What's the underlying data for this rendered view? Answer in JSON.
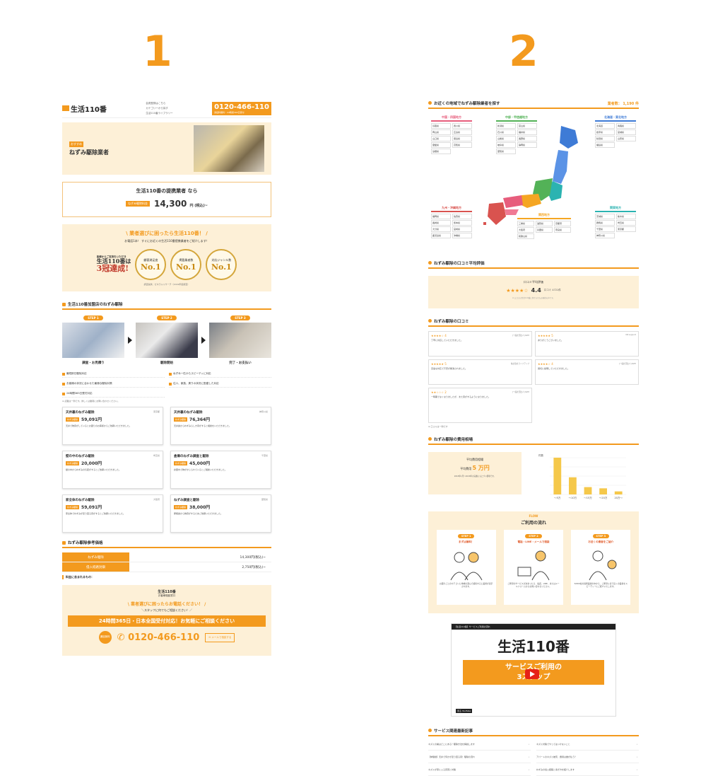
{
  "labels": {
    "one": "1",
    "two": "2"
  },
  "colors": {
    "accent": "#f39a1e",
    "bg_cream": "#fdf0d7"
  },
  "left": {
    "header": {
      "logo": "生活110番",
      "links": [
        "会員登録はこちら",
        "カテゴリーから探す",
        "生活110番ライブラリー"
      ],
      "phone": "0120-466-110",
      "phone_note": "通話料無料・24時間365日受付"
    },
    "hero": {
      "tag": "おすすめ",
      "title": "ねずみ駆除業者"
    },
    "price": {
      "headline": "生活110番の提携業者 なら",
      "label": "ねずみ駆除料金",
      "value": "14,300",
      "unit": "円 (税込)~"
    },
    "award": {
      "heading": "\\ 業者選びに困ったら生活110番！ /",
      "sub": "お電話1本！ すぐにお近くの生活110番提携業者をご紹介します！",
      "main1": "皆様からご支持をいただき",
      "main2": "生活110番は",
      "main3": "3冠達成!",
      "medals": [
        {
          "cap": "顧客満足度",
          "num": "No.1"
        },
        {
          "cap": "掲載業者数",
          "num": "No.1"
        },
        {
          "cap": "対応ジャンル数",
          "num": "No.1"
        }
      ],
      "note": "調査提供：ゼネラルリサーチ（2019年度調査）"
    },
    "steps_title": "生活110番加盟店のねずみ駆除",
    "steps": [
      {
        "badge": "STEP 1",
        "caption": "調査・お見積り"
      },
      {
        "badge": "STEP 2",
        "caption": "駆除開始"
      },
      {
        "badge": "STEP 3",
        "caption": "完了・お支払い"
      }
    ],
    "checks": [
      "最短即日駆除対応",
      "ねずみ一匹からスピーディに対応",
      "お客様の状況に合わせた最適な駆除対策",
      "住人、家族、周りの状況に配慮した対応",
      "24時間365日受付対応"
    ],
    "small_note": "※ 記載は一例です。詳しくは業者にお問い合わせください。",
    "cases": [
      {
        "title": "天井裏のねずみ駆除",
        "area": "東京都",
        "label": "ねずみ駆除",
        "price": "59,091円",
        "desc": "天井で物音がしているとお困りのお客様からご依頼いただきました。"
      },
      {
        "title": "天井裏のねずみ駆除",
        "area": "神奈川県",
        "label": "ねずみ駆除",
        "price": "76,364円",
        "desc": "天井裏からねずみらしき音がすると相談をいただきました。"
      },
      {
        "title": "壁の中のねずみ駆除",
        "area": "埼玉県",
        "label": "ねずみ駆除",
        "price": "20,000円",
        "desc": "壁の中からねずみの気配がするとご依頼いただきました。"
      },
      {
        "title": "倉庫のねずみ調査と駆除",
        "area": "千葉県",
        "label": "ねずみ駆除",
        "price": "45,000円",
        "desc": "倉庫内で物がかじられているとご相談いただきました。"
      },
      {
        "title": "家全体のねずみ駆除",
        "area": "大阪府",
        "label": "ねずみ駆除",
        "price": "59,091円",
        "desc": "家全体でねずみが走り回る音がするとご依頼いただきました。"
      },
      {
        "title": "ねずみ調査と駆除",
        "area": "愛知県",
        "label": "ねずみ駆除",
        "price": "38,000円",
        "desc": "屋根裏から物音がするためご依頼いただきました。"
      }
    ],
    "ref_title": "ねずみ駆除参考価格",
    "ref_rows": [
      {
        "k": "ねずみ駆除",
        "v": "14,300円(税込)~"
      },
      {
        "k": "侵入経路封鎖",
        "v": "2,750円(税込)~"
      }
    ],
    "included": "料金に含まれるもの：",
    "cta": {
      "logo": "生活110番",
      "logo_sub": "お客様相談窓口",
      "heading": "\\ 業者選びに困ったらお電話ください！ /",
      "sub": "＼スタッフに何でもご相談ください！／",
      "band": "24時間365日・日本全国受付対応！お気軽にご相談ください",
      "circle": "通話無料",
      "tel": "0120-466-110",
      "mail": "メールで相談する"
    }
  },
  "right": {
    "map_title": "お近くの地域でねずみ駆除業者を探す",
    "count": "業者数： 1,190 件",
    "regions": [
      {
        "name": "中国・四国地方",
        "color": "#e75d7c",
        "prefs": [
          "鳥取県",
          "香川県",
          "岡山県",
          "広島県",
          "山口県",
          "徳島県",
          "愛媛県",
          "高知県",
          "島根県"
        ]
      },
      {
        "name": "中部・甲信越地方",
        "color": "#53b257",
        "prefs": [
          "新潟県",
          "富山県",
          "石川県",
          "福井県",
          "山梨県",
          "長野県",
          "岐阜県",
          "静岡県",
          "愛知県"
        ]
      },
      {
        "name": "北海道・東北地方",
        "color": "#3e7bd6",
        "prefs": [
          "北海道",
          "青森県",
          "岩手県",
          "宮城県",
          "秋田県",
          "山形県",
          "福島県"
        ]
      },
      {
        "name": "九州・沖縄地方",
        "color": "#d9534f",
        "prefs": [
          "福岡県",
          "佐賀県",
          "長崎県",
          "熊本県",
          "大分県",
          "宮崎県",
          "鹿児島県",
          "沖縄県"
        ]
      },
      {
        "name": "関西地方",
        "color": "#f5a623",
        "prefs": [
          "三重県",
          "滋賀県",
          "京都府",
          "大阪府",
          "兵庫県",
          "奈良県",
          "和歌山県"
        ]
      },
      {
        "name": "関東地方",
        "color": "#2bb3b1",
        "prefs": [
          "茨城県",
          "栃木県",
          "群馬県",
          "埼玉県",
          "千葉県",
          "東京都",
          "神奈川県"
        ]
      }
    ],
    "rating_title": "ねずみ駆除の口コミ平均評価",
    "rating": {
      "label": "口コミ平均評価",
      "stars": "★★★★☆",
      "score": "4.4",
      "count": "口コミ 4721件",
      "note": "※ 口コミは生活110番に寄せられたお客様の声です。"
    },
    "reviews_title": "ねずみ駆除の口コミ",
    "reviews": [
      {
        "stars": "★★★★☆",
        "score": "4",
        "company": "[一般社団法人] NZH",
        "text": "丁寧に対応していただきました。"
      },
      {
        "stars": "★★★★★",
        "score": "5",
        "company": "NZ support",
        "text": "ありがとうございました。"
      },
      {
        "stars": "★★★★★",
        "score": "5",
        "company": "株式会社ライフアップ",
        "text": "迅速な対応で不安が解消されました。"
      },
      {
        "stars": "★★★★☆",
        "score": "4",
        "company": "[一般社団法人] NZH",
        "text": "親切に説明していただきました。"
      },
      {
        "stars": "★★☆☆☆",
        "score": "2",
        "company": "[一般社団法人] NZH",
        "text": "一時期でなくなりましたが、また音がするようになりました。"
      }
    ],
    "reviews_note": "※ 口コミは一例です",
    "cost_title": "ねずみ駆除の費用相場",
    "cost": {
      "label": "平均費用相場",
      "avg_label": "平均費用",
      "avg": "5 万円",
      "note": "2018年1月〜2020年の実績にもとづく相場です。"
    },
    "chart_data": {
      "type": "bar",
      "categories": [
        "〜5万",
        "〜10万",
        "〜15万",
        "〜20万",
        "20万〜"
      ],
      "values": [
        60,
        28,
        12,
        10,
        5
      ],
      "ylabel": "件数",
      "ylim": [
        0,
        60
      ]
    },
    "flow": {
      "label": "FLOW",
      "title": "ご利用の流れ",
      "steps": [
        {
          "badge": "STEP 1",
          "title": "まずは無料！",
          "desc": "お困りごとのカテゴリと地域を選んで検索すると業者が表示されます。"
        },
        {
          "badge": "STEP 2",
          "title": "電話・LINE・メールで相談",
          "desc": "ご希望のサービスが決まったら、電話、LINE、またはメールフォームからお問い合わせください。"
        },
        {
          "badge": "STEP 3",
          "title": "お近くの業者をご紹介",
          "desc": "8,800社の提携業者の中から、ご希望に合う近くの業者をスピーディーにご紹介いたします。"
        }
      ]
    },
    "video": {
      "bar": "【生活110番】サービスご利用の流れ",
      "logo": "生活110番",
      "line1": "サービスご利用の",
      "line2": "3ステップ",
      "yt": "見る YouTube"
    },
    "news_title": "サービス関連最新記事",
    "news": [
      "ネズミの巣はどこにある？駆除方法を解説します",
      "ネズミ対策でやってはいけないこと",
      "【体験談】天井で何かが走り回る音！駆除の流れ",
      "アパートのネズミ被害、費用は誰が払う？",
      "ネズミが家に入る原因と対策",
      "ねずみの侵入経路と塞ぎ方を紹介します"
    ]
  }
}
